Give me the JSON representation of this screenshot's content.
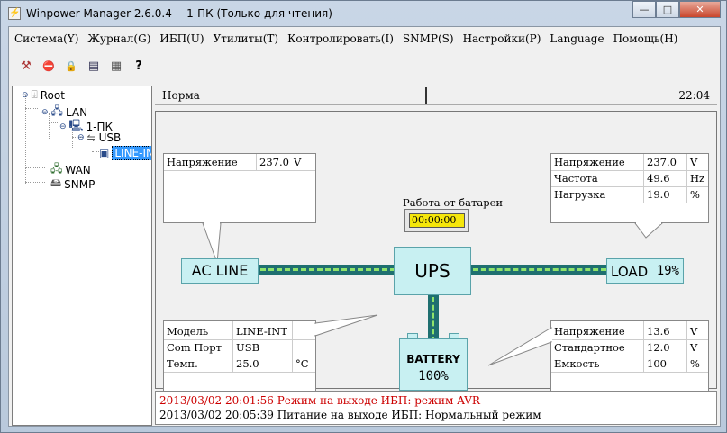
{
  "window": {
    "title": "Winpower Manager 2.6.0.4 -- 1-ПК (Только для чтения) --",
    "buttons": {
      "minimize": "—",
      "maximize": "□",
      "close": "✕"
    }
  },
  "menu": [
    "Система(Y)",
    "Журнал(G)",
    "ИБП(U)",
    "Утилиты(T)",
    "Контролировать(I)",
    "SNMP(S)",
    "Настройки(P)",
    "Language",
    "Помощь(H)"
  ],
  "toolbar": [
    {
      "name": "tools-icon",
      "glyph": "⚒"
    },
    {
      "name": "schedule-icon",
      "glyph": "⛔"
    },
    {
      "name": "lock-icon",
      "glyph": "🔒"
    },
    {
      "name": "monitor-icon",
      "glyph": "▤"
    },
    {
      "name": "calculator-icon",
      "glyph": "▦"
    },
    {
      "name": "help-icon",
      "glyph": "?"
    }
  ],
  "tree": {
    "root": "Root",
    "lan": "LAN",
    "pc": "1-ПК",
    "usb": "USB",
    "device": "LINE-INT",
    "wan": "WAN",
    "snmp": "SNMP"
  },
  "status": {
    "mode": "Норма",
    "time": "22:04"
  },
  "input_panel": {
    "label": "Напряжение",
    "value": "237.0",
    "unit": "V"
  },
  "output_panel": {
    "rows": [
      {
        "label": "Напряжение",
        "value": "237.0",
        "unit": "V"
      },
      {
        "label": "Частота",
        "value": "49.6",
        "unit": "Hz"
      },
      {
        "label": "Нагрузка",
        "value": "19.0",
        "unit": "%"
      }
    ]
  },
  "battery_time": {
    "label": "Работа от батареи",
    "value": "00:00:00"
  },
  "info_panel": {
    "rows": [
      {
        "label": "Модель",
        "value": "LINE-INT",
        "unit": ""
      },
      {
        "label": "Com Порт",
        "value": "USB",
        "unit": ""
      },
      {
        "label": "Темп.",
        "value": "25.0",
        "unit": "°C"
      }
    ]
  },
  "battery_panel": {
    "rows": [
      {
        "label": "Напряжение",
        "value": "13.6",
        "unit": "V"
      },
      {
        "label": "Стандартное",
        "value": "12.0",
        "unit": "V"
      },
      {
        "label": "Емкость",
        "value": "100",
        "unit": "%"
      }
    ]
  },
  "devices": {
    "ac_line": "AC LINE",
    "ups": "UPS",
    "load": "LOAD",
    "load_percent": "19%",
    "battery": "BATTERY",
    "battery_percent": "100%"
  },
  "colors": {
    "bus": "#1f6f70",
    "dash": "#8fe36b",
    "device_fill": "#c8f0f2",
    "log_alert": "#cc0000"
  },
  "log": [
    {
      "text": "2013/03/02 20:01:56  Режим на выходе ИБП: режим AVR",
      "color": "#cc0000"
    },
    {
      "text": "2013/03/02 20:05:39  Питание на выходе ИБП: Нормальный режим",
      "color": "#000000"
    }
  ]
}
